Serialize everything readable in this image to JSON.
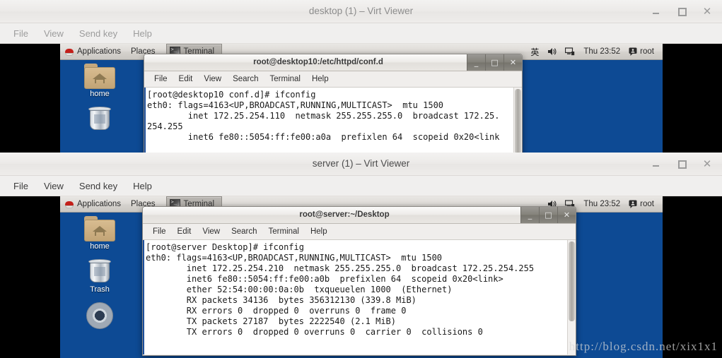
{
  "windows": [
    {
      "id": "desktop-vm",
      "title": "desktop (1) – Virt Viewer",
      "menus": [
        "File",
        "View",
        "Send key",
        "Help"
      ],
      "controls": {
        "minimize": "_",
        "maximize": "□",
        "close": "✕"
      },
      "panel": {
        "applications": "Applications",
        "places": "Places",
        "task": "Terminal",
        "ime": "英",
        "clock": "Thu 23:52",
        "user": "root"
      },
      "desktop_icons": [
        {
          "name": "home",
          "type": "folder"
        },
        {
          "name": "",
          "type": "trash"
        }
      ],
      "terminal": {
        "title": "root@desktop10:/etc/httpd/conf.d",
        "menus": [
          "File",
          "Edit",
          "View",
          "Search",
          "Terminal",
          "Help"
        ],
        "lines": [
          "[root@desktop10 conf.d]# ifconfig",
          "eth0: flags=4163<UP,BROADCAST,RUNNING,MULTICAST>  mtu 1500",
          "        inet 172.25.254.110  netmask 255.255.255.0  broadcast 172.25.",
          "254.255",
          "        inet6 fe80::5054:ff:fe00:a0a  prefixlen 64  scopeid 0x20<link"
        ]
      }
    },
    {
      "id": "server-vm",
      "title": "server (1) – Virt Viewer",
      "menus": [
        "File",
        "View",
        "Send key",
        "Help"
      ],
      "controls": {
        "minimize": "_",
        "maximize": "□",
        "close": "✕"
      },
      "panel": {
        "applications": "Applications",
        "places": "Places",
        "task": "Terminal",
        "ime": "",
        "clock": "Thu 23:52",
        "user": "root"
      },
      "desktop_icons": [
        {
          "name": "home",
          "type": "folder"
        },
        {
          "name": "Trash",
          "type": "trash"
        },
        {
          "name": "",
          "type": "disc"
        }
      ],
      "terminal": {
        "title": "root@server:~/Desktop",
        "menus": [
          "File",
          "Edit",
          "View",
          "Search",
          "Terminal",
          "Help"
        ],
        "lines": [
          "[root@server Desktop]# ifconfig",
          "eth0: flags=4163<UP,BROADCAST,RUNNING,MULTICAST>  mtu 1500",
          "        inet 172.25.254.210  netmask 255.255.255.0  broadcast 172.25.254.255",
          "        inet6 fe80::5054:ff:fe00:a0b  prefixlen 64  scopeid 0x20<link>",
          "        ether 52:54:00:00:0a:0b  txqueuelen 1000  (Ethernet)",
          "        RX packets 34136  bytes 356312130 (339.8 MiB)",
          "        RX errors 0  dropped 0  overruns 0  frame 0",
          "        TX packets 27187  bytes 2222540 (2.1 MiB)",
          "        TX errors 0  dropped 0 overruns 0  carrier 0  collisions 0"
        ]
      }
    }
  ],
  "watermark": "http://blog.csdn.net/xix1x1",
  "colors": {
    "desktop_blue": "#0d4a94",
    "chrome": "#f0efee",
    "redhat_red": "#c3201a"
  }
}
